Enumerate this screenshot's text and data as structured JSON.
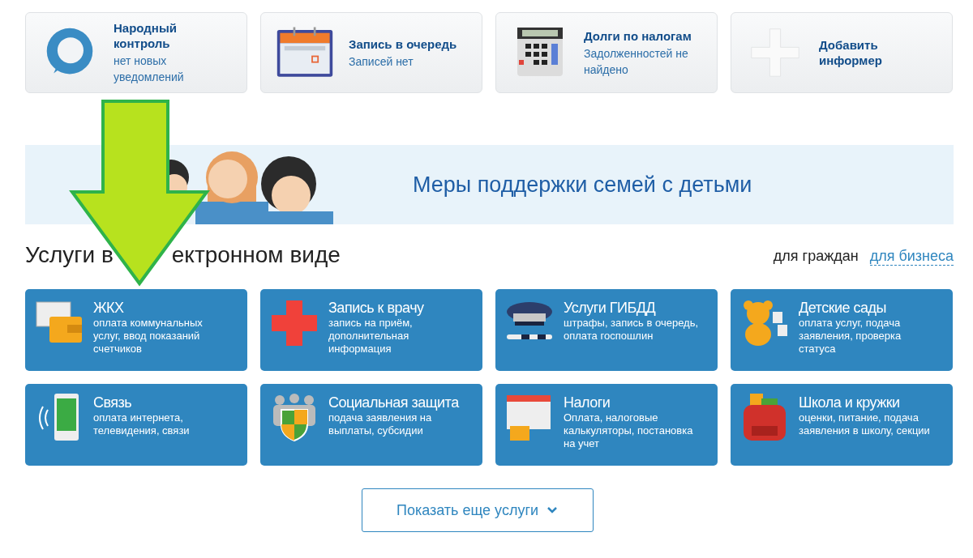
{
  "informers": [
    {
      "kind": "chat",
      "title": "Народный контроль",
      "subtitle": "нет новых уведомлений"
    },
    {
      "kind": "calendar",
      "title": "Запись в очередь",
      "subtitle": "Записей нет"
    },
    {
      "kind": "calculator",
      "title": "Долги по налогам",
      "subtitle": "Задолженностей не найдено"
    },
    {
      "kind": "plus",
      "title": "Добавить информер"
    }
  ],
  "banner": {
    "text": "Меры поддержки семей с детьми"
  },
  "services": {
    "heading_parts": [
      "Услуги в",
      "ектронном виде"
    ],
    "audience_tabs": [
      {
        "label": "для граждан",
        "selected": true
      },
      {
        "label": "для бизнеса",
        "selected": false
      }
    ],
    "tiles": [
      {
        "kind": "wallet",
        "title": "ЖКХ",
        "description": "оплата коммунальных услуг, ввод показаний счетчиков"
      },
      {
        "kind": "cross",
        "title": "Запись к врачу",
        "description": "запись на приём, дополнительная информация"
      },
      {
        "kind": "cap",
        "title": "Услуги ГИБДД",
        "description": "штрафы, запись в очередь, оплата госпошлин"
      },
      {
        "kind": "bear",
        "title": "Детские сады",
        "description": "оплата услуг, подача заявления, проверка статуса"
      },
      {
        "kind": "phone",
        "title": "Связь",
        "description": "оплата интернета, телевидения, связи"
      },
      {
        "kind": "shield",
        "title": "Социальная защита",
        "description": "подача заявления на выплаты, субсидии"
      },
      {
        "kind": "taxcal",
        "title": "Налоги",
        "description": "Оплата, налоговые калькуляторы, постановка на учет"
      },
      {
        "kind": "backpack",
        "title": "Школа и кружки",
        "description": "оценки, питание, подача заявления в школу, секции"
      }
    ],
    "more_button": "Показать еще услуги"
  }
}
